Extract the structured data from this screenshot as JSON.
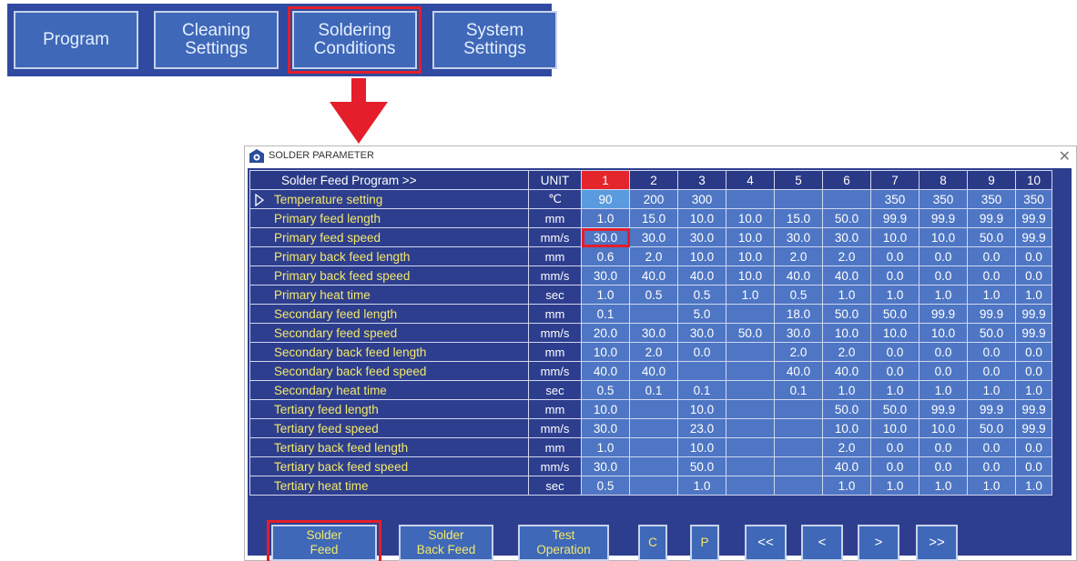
{
  "menu": {
    "buttons": [
      {
        "line1": "Program",
        "line2": ""
      },
      {
        "line1": "Cleaning",
        "line2": "Settings"
      },
      {
        "line1": "Soldering",
        "line2": "Conditions"
      },
      {
        "line1": "System",
        "line2": "Settings"
      }
    ],
    "highlighted": "Soldering Conditions"
  },
  "colors": {
    "menu_bg": "#2f4aa0",
    "button_bg": "#3f68b8",
    "table_bg": "#2e3e8f",
    "value_bg": "#4e76c4",
    "label_text": "#f3e96a",
    "highlight": "#e41e2a"
  },
  "window": {
    "title": "SOLDER PARAMETER",
    "icon": "app-logo-icon",
    "close": "✕"
  },
  "table": {
    "header_title": "Solder Feed Program >>",
    "unit_header": "UNIT",
    "columns": [
      "1",
      "2",
      "3",
      "4",
      "5",
      "6",
      "7",
      "8",
      "9",
      "10"
    ],
    "selected_column": "1",
    "rows": [
      {
        "label": "Temperature setting",
        "unit": "℃",
        "values": [
          "90",
          "200",
          "300",
          "",
          "",
          "",
          "350",
          "350",
          "350",
          "350"
        ]
      },
      {
        "label": "Primary feed length",
        "unit": "mm",
        "values": [
          "1.0",
          "15.0",
          "10.0",
          "10.0",
          "15.0",
          "50.0",
          "99.9",
          "99.9",
          "99.9",
          "99.9"
        ]
      },
      {
        "label": "Primary feed speed",
        "unit": "mm/s",
        "values": [
          "30.0",
          "30.0",
          "30.0",
          "10.0",
          "30.0",
          "30.0",
          "10.0",
          "10.0",
          "50.0",
          "99.9"
        ]
      },
      {
        "label": "Primary back feed length",
        "unit": "mm",
        "values": [
          "0.6",
          "2.0",
          "10.0",
          "10.0",
          "2.0",
          "2.0",
          "0.0",
          "0.0",
          "0.0",
          "0.0"
        ]
      },
      {
        "label": "Primary back feed speed",
        "unit": "mm/s",
        "values": [
          "30.0",
          "40.0",
          "40.0",
          "10.0",
          "40.0",
          "40.0",
          "0.0",
          "0.0",
          "0.0",
          "0.0"
        ]
      },
      {
        "label": "Primary heat time",
        "unit": "sec",
        "values": [
          "1.0",
          "0.5",
          "0.5",
          "1.0",
          "0.5",
          "1.0",
          "1.0",
          "1.0",
          "1.0",
          "1.0"
        ]
      },
      {
        "label": "Secondary feed length",
        "unit": "mm",
        "values": [
          "0.1",
          "",
          "5.0",
          "",
          "18.0",
          "50.0",
          "50.0",
          "99.9",
          "99.9",
          "99.9"
        ]
      },
      {
        "label": "Secondary feed speed",
        "unit": "mm/s",
        "values": [
          "20.0",
          "30.0",
          "30.0",
          "50.0",
          "30.0",
          "10.0",
          "10.0",
          "10.0",
          "50.0",
          "99.9"
        ]
      },
      {
        "label": "Secondary back feed length",
        "unit": "mm",
        "values": [
          "10.0",
          "2.0",
          "0.0",
          "",
          "2.0",
          "2.0",
          "0.0",
          "0.0",
          "0.0",
          "0.0"
        ]
      },
      {
        "label": "Secondary back feed speed",
        "unit": "mm/s",
        "values": [
          "40.0",
          "40.0",
          "",
          "",
          "40.0",
          "40.0",
          "0.0",
          "0.0",
          "0.0",
          "0.0"
        ]
      },
      {
        "label": "Secondary heat time",
        "unit": "sec",
        "values": [
          "0.5",
          "0.1",
          "0.1",
          "",
          "0.1",
          "1.0",
          "1.0",
          "1.0",
          "1.0",
          "1.0"
        ]
      },
      {
        "label": "Tertiary feed length",
        "unit": "mm",
        "values": [
          "10.0",
          "",
          "10.0",
          "",
          "",
          "50.0",
          "50.0",
          "99.9",
          "99.9",
          "99.9"
        ]
      },
      {
        "label": "Tertiary feed speed",
        "unit": "mm/s",
        "values": [
          "30.0",
          "",
          "23.0",
          "",
          "",
          "10.0",
          "10.0",
          "10.0",
          "50.0",
          "99.9"
        ]
      },
      {
        "label": "Tertiary back feed length",
        "unit": "mm",
        "values": [
          "1.0",
          "",
          "10.0",
          "",
          "",
          "2.0",
          "0.0",
          "0.0",
          "0.0",
          "0.0"
        ]
      },
      {
        "label": "Tertiary back feed speed",
        "unit": "mm/s",
        "values": [
          "30.0",
          "",
          "50.0",
          "",
          "",
          "40.0",
          "0.0",
          "0.0",
          "0.0",
          "0.0"
        ]
      },
      {
        "label": "Tertiary heat time",
        "unit": "sec",
        "values": [
          "0.5",
          "",
          "1.0",
          "",
          "",
          "1.0",
          "1.0",
          "1.0",
          "1.0",
          "1.0"
        ]
      }
    ]
  },
  "bottom_buttons": {
    "solder_feed": {
      "line1": "Solder",
      "line2": "Feed"
    },
    "solder_back_feed": {
      "line1": "Solder",
      "line2": "Back Feed"
    },
    "test_operation": {
      "line1": "Test",
      "line2": "Operation"
    },
    "c": "C",
    "p": "P",
    "first": "<<",
    "prev": "<",
    "next": ">",
    "last": ">>"
  }
}
